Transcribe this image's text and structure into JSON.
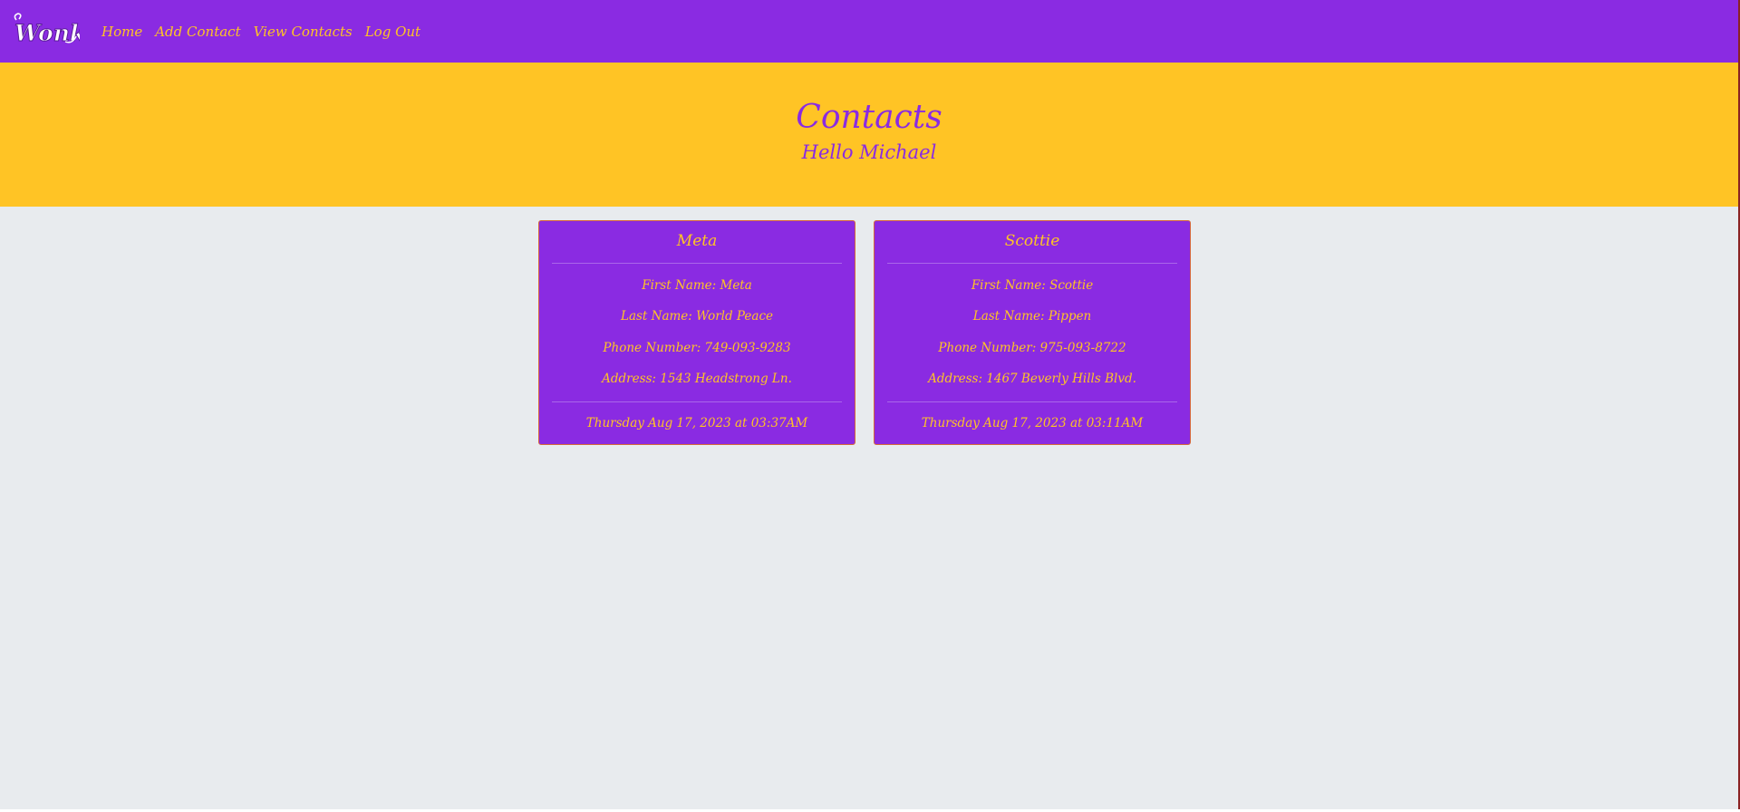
{
  "nav": {
    "logo_text": "Wonka",
    "links": [
      "Home",
      "Add Contact",
      "View Contacts",
      "Log Out"
    ]
  },
  "hero": {
    "title": "Contacts",
    "subtitle": "Hello Michael"
  },
  "contacts": [
    {
      "name": "Meta",
      "first_name": "First Name: Meta",
      "last_name": "Last Name: World Peace",
      "phone": "Phone Number: 749-093-9283",
      "address": "Address: 1543 Headstrong Ln.",
      "timestamp": "Thursday Aug 17, 2023 at 03:37AM"
    },
    {
      "name": "Scottie",
      "first_name": "First Name: Scottie",
      "last_name": "Last Name: Pippen",
      "phone": "Phone Number: 975-093-8722",
      "address": "Address: 1467 Beverly Hills Blvd.",
      "timestamp": "Thursday Aug 17, 2023 at 03:11AM"
    }
  ],
  "colors": {
    "purple": "#8a2be2",
    "gold": "#ffc425",
    "background": "#e8ebee"
  }
}
